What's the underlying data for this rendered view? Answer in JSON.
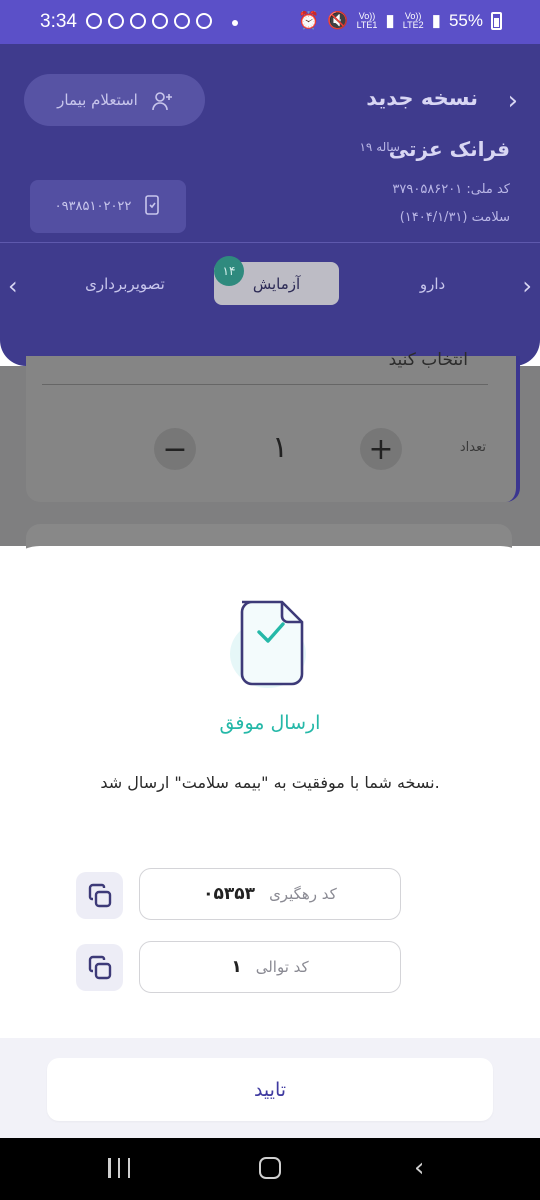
{
  "status_bar": {
    "time": "3:34",
    "battery": "55%",
    "lte1": "LTE1",
    "lte2": "LTE2",
    "volte": "Vo))"
  },
  "header": {
    "title": "نسخه جدید",
    "inquiry_button": "استعلام بیمار",
    "patient_name": "فرانک عزتی",
    "patient_age": "۱۹ ساله",
    "phone": "۰۹۳۸۵۱۰۲۰۲۲",
    "national_id": "کد ملی: ۳۷۹۰۵۸۶۲۰۱",
    "insurance": "سلامت  (۱۴۰۴/۱/۳۱)"
  },
  "tabs": {
    "items": [
      {
        "label": "تصویربرداری"
      },
      {
        "label": "آزمایش"
      },
      {
        "label": "دارو"
      }
    ],
    "active_index": 1,
    "badge": "۱۴"
  },
  "background_form": {
    "select_placeholder": "انتخاب کنید",
    "quantity_label": "تعداد",
    "quantity_value": "۱"
  },
  "dialog": {
    "title": "ارسال موفق",
    "message": "نسخه شما با موفقیت به \"بیمه سلامت\" ارسال شد.",
    "tracking_label": "کد رهگیری",
    "tracking_value": "۰۵۳۵۳",
    "sequence_label": "کد توالی",
    "sequence_value": "۱",
    "confirm": "تایید"
  },
  "colors": {
    "primary": "#5b50c8",
    "success": "#25b8a8",
    "confirm_text": "#3f3aa0"
  }
}
